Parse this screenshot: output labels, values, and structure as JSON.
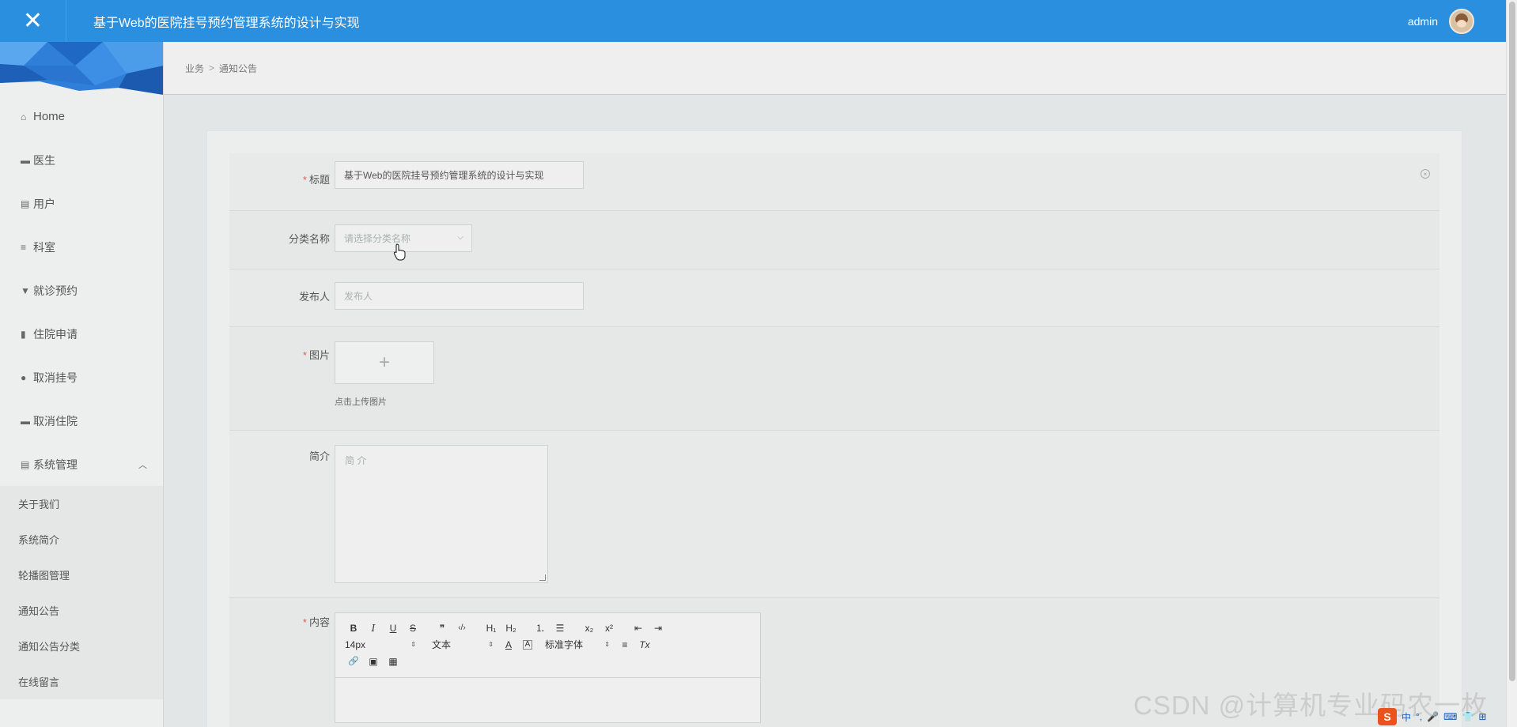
{
  "app": {
    "close_icon": "close-icon",
    "title": "基于Web的医院挂号预约管理系统的设计与实现",
    "username": "admin"
  },
  "sidebar": {
    "items": [
      {
        "label": "Home",
        "icon": "home-icon",
        "glyph": "⌂"
      },
      {
        "label": "医生",
        "icon": "comment-icon",
        "glyph": "▬"
      },
      {
        "label": "用户",
        "icon": "clipboard-icon",
        "glyph": "▤"
      },
      {
        "label": "科室",
        "icon": "sliders-icon",
        "glyph": "≡"
      },
      {
        "label": "就诊预约",
        "icon": "thumbtack-icon",
        "glyph": "▼"
      },
      {
        "label": "住院申请",
        "icon": "bar-chart-icon",
        "glyph": "▮"
      },
      {
        "label": "取消挂号",
        "icon": "map-pin-icon",
        "glyph": "●"
      },
      {
        "label": "取消住院",
        "icon": "briefcase-icon",
        "glyph": "▬"
      },
      {
        "label": "系统管理",
        "icon": "clipboard-check-icon",
        "glyph": "▤",
        "caret": "︿"
      }
    ],
    "subitems": [
      "关于我们",
      "系统简介",
      "轮播图管理",
      "通知公告",
      "通知公告分类",
      "在线留言"
    ]
  },
  "breadcrumb": {
    "items": [
      "业务",
      "通知公告"
    ],
    "separator": ">"
  },
  "form": {
    "title": {
      "label": "标题",
      "required": "*",
      "value": "基于Web的医院挂号预约管理系统的设计与实现",
      "clear_glyph": "×"
    },
    "category": {
      "label": "分类名称",
      "placeholder": "请选择分类名称",
      "chevron": "⌵"
    },
    "publisher": {
      "label": "发布人",
      "placeholder": "发布人"
    },
    "image": {
      "label": "图片",
      "required": "*",
      "plus": "+",
      "hint": "点击上传图片"
    },
    "summary": {
      "label": "简介",
      "placeholder": "简 介"
    },
    "content": {
      "label": "内容",
      "required": "*",
      "toolbar_row1": [
        "B",
        "I",
        "U",
        "S",
        "❞",
        "‹/›",
        "H₁",
        "H₂",
        "⒈",
        "☰",
        "x₂",
        "x²",
        "⇤",
        "⇥"
      ],
      "size": "14px",
      "text_type": "文本",
      "font": "标准字体",
      "align": "≡",
      "clear_format": "Tx",
      "toolbar_row3": [
        "🔗",
        "▣",
        "▦"
      ],
      "color_a": "A",
      "bg_a": "A",
      "select_arrow": "⇕"
    }
  },
  "watermark": "CSDN @计算机专业码农一枚",
  "ime": {
    "s": "S",
    "items": [
      "中",
      "°,",
      "🎤",
      "⌨",
      "👕",
      "⊞"
    ]
  },
  "colors": {
    "header": "#2a8fdf",
    "required": "#e05a5a"
  }
}
